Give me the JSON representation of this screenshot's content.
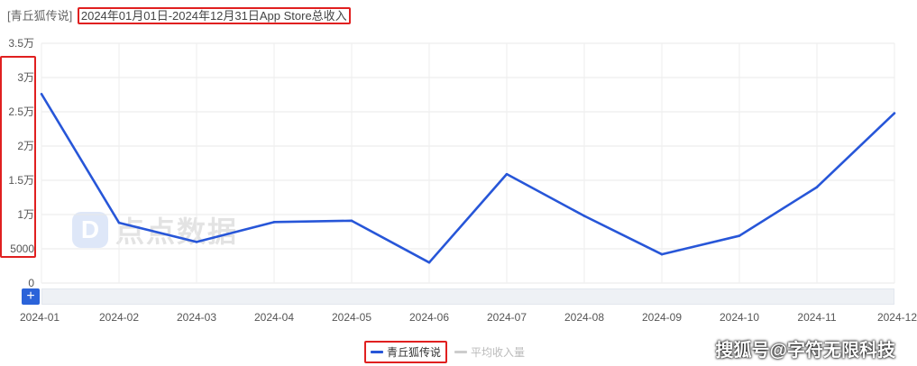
{
  "header": {
    "app_name": "[青丘狐传说]",
    "range_label": "2024年01月01日-2024年12月31日App Store总收入"
  },
  "watermark": {
    "logo_letter": "D",
    "text": "点点数据"
  },
  "zoom": {
    "button_label": "+"
  },
  "chart_data": {
    "type": "line",
    "title": "2024年01月01日-2024年12月31日App Store总收入",
    "x": [
      "2024-01",
      "2024-02",
      "2024-03",
      "2024-04",
      "2024-05",
      "2024-06",
      "2024-07",
      "2024-08",
      "2024-09",
      "2024-10",
      "2024-11",
      "2024-12"
    ],
    "series": [
      {
        "name": "青丘狐传说",
        "color": "#2756d8",
        "values": [
          27600,
          8800,
          6000,
          8900,
          9100,
          3000,
          15900,
          9800,
          4200,
          6900,
          14000,
          24800
        ]
      }
    ],
    "ylim": [
      0,
      35000
    ],
    "yticks": [
      0,
      5000,
      10000,
      15000,
      20000,
      25000,
      30000,
      35000
    ],
    "ytick_labels": [
      "0",
      "5000",
      "1万",
      "1.5万",
      "2万",
      "2.5万",
      "3万",
      "3.5万"
    ],
    "grid": true
  },
  "legend": [
    {
      "label": "青丘狐传说",
      "color": "#2756d8",
      "active": true
    },
    {
      "label": "平均收入量",
      "color": "#cccccc",
      "active": false
    }
  ],
  "credit": "搜狐号@字符无限科技"
}
